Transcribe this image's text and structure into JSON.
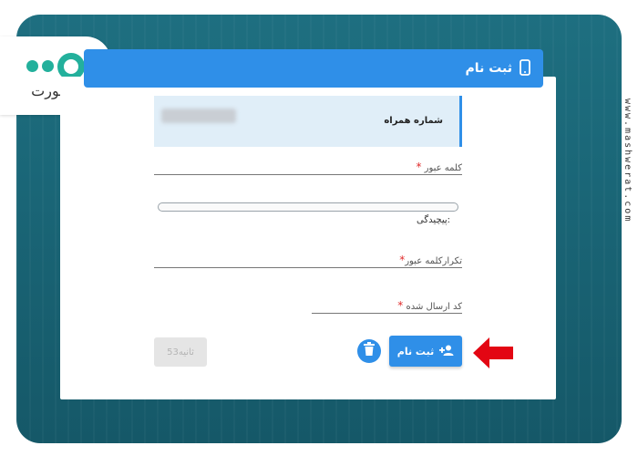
{
  "brand": {
    "logo_text": "مـــورت",
    "watermark": "www.mashwerat.com"
  },
  "header": {
    "title": "ثبت نام"
  },
  "phone": {
    "label": "شماره همراه",
    "value": "09*******"
  },
  "fields": {
    "password_label": "کلمه عبور",
    "complexity_label": "پیچیدگی:",
    "repeat_password_label": "تکرارکلمه عبور",
    "code_label": "کد ارسال شده"
  },
  "buttons": {
    "timer_label": "53ثانیه",
    "submit_label": "ثبت نام"
  },
  "colors": {
    "accent": "#2f8fe8",
    "required": "#e02b2b",
    "arrow": "#e30613",
    "logo": "#23b09c"
  }
}
